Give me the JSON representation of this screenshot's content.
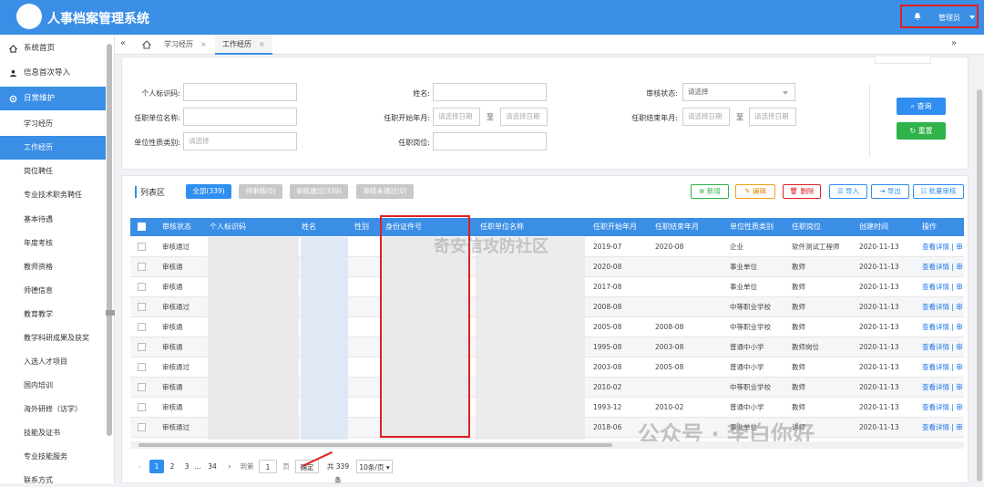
{
  "app": {
    "title": "人事档案管理系统",
    "user": "管理员"
  },
  "sidebar": {
    "items": [
      {
        "label": "系统首页"
      },
      {
        "label": "信息首次导入"
      },
      {
        "label": "日常维护"
      }
    ],
    "sub": [
      "学习经历",
      "工作经历",
      "岗位聘任",
      "专业技术职务聘任",
      "基本待遇",
      "年度考核",
      "教师资格",
      "师德信息",
      "教育教学",
      "教学科研成果及获奖",
      "入选人才项目",
      "国内培训",
      "海外研修（访学）",
      "技能及证书",
      "专业技能服务",
      "联系方式"
    ]
  },
  "tabs": [
    {
      "label": "学习经历"
    },
    {
      "label": "工作经历"
    }
  ],
  "search": {
    "labels": {
      "id": "个人标识码:",
      "name": "姓名:",
      "status": "审核状态:",
      "org": "任职单位名称:",
      "start": "任职开始年月:",
      "end": "任职结束年月:",
      "nature": "单位性质类别:",
      "post": "任职岗位:"
    },
    "placeholders": {
      "select": "请选择",
      "date": "请选择日期"
    },
    "to": "至",
    "query": "查询",
    "reset": "重置"
  },
  "list": {
    "title": "列表区",
    "filters": [
      "全部(339)",
      "待审核(0)",
      "审核通过(339)",
      "审核未通过(0)"
    ],
    "actions": [
      "新增",
      "编辑",
      "删除",
      "导入",
      "导出",
      "批量审核"
    ]
  },
  "table": {
    "headers": [
      "审核状态",
      "个人标识码",
      "姓名",
      "性别",
      "身份证件号",
      "任职单位名称",
      "任职开始年月",
      "任职结束年月",
      "单位性质类别",
      "任职岗位",
      "创建时间",
      "操作"
    ],
    "rows": [
      {
        "status": "审核通过",
        "start": "2019-07",
        "end": "2020-08",
        "nature": "企业",
        "post": "软件测试工程师",
        "created": "2020-11-13"
      },
      {
        "status": "审核通",
        "start": "2020-08",
        "end": "",
        "nature": "事业单位",
        "post": "教师",
        "created": "2020-11-13"
      },
      {
        "status": "审核通",
        "start": "2017-08",
        "end": "",
        "nature": "事业单位",
        "post": "教师",
        "created": "2020-11-13"
      },
      {
        "status": "审核通过",
        "start": "2008-08",
        "end": "",
        "nature": "中等职业学校",
        "post": "教师",
        "created": "2020-11-13"
      },
      {
        "status": "审核通",
        "start": "2005-08",
        "end": "2008-08",
        "nature": "中等职业学校",
        "post": "教师",
        "created": "2020-11-13"
      },
      {
        "status": "审核通",
        "start": "1995-08",
        "end": "2003-08",
        "nature": "普通中小学",
        "post": "教师岗位",
        "created": "2020-11-13"
      },
      {
        "status": "审核通过",
        "start": "2003-08",
        "end": "2005-08",
        "nature": "普通中小学",
        "post": "教师",
        "created": "2020-11-13"
      },
      {
        "status": "审核通",
        "start": "2010-02",
        "end": "",
        "nature": "中等职业学校",
        "post": "教师",
        "created": "2020-11-13"
      },
      {
        "status": "审核通",
        "start": "1993-12",
        "end": "2010-02",
        "nature": "普通中小学",
        "post": "教师",
        "created": "2020-11-13"
      },
      {
        "status": "审核通过",
        "start": "2018-06",
        "end": "",
        "nature": "事业单位",
        "post": "讲师",
        "created": "2020-11-13"
      }
    ],
    "op": "查看详情 | 审"
  },
  "pager": {
    "pages": [
      "1",
      "2",
      "3",
      "...",
      "34"
    ],
    "goto": "到第",
    "page": "1",
    "unit": "页",
    "confirm": "确定",
    "total": "共 339 条",
    "size": "10条/页"
  },
  "watermark": {
    "a": "奇安信攻防社区",
    "b": "公众号 · 李白你好"
  },
  "colors": {
    "primary": "#3a8ee6",
    "success": "#2fb34a",
    "danger": "#e02020"
  }
}
